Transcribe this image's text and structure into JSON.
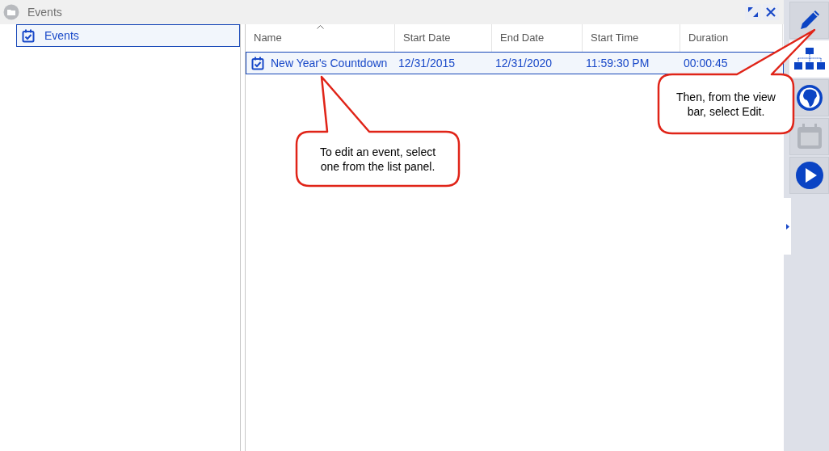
{
  "window": {
    "title": "Events"
  },
  "tree": {
    "items": [
      {
        "label": "Events",
        "selected": true
      }
    ]
  },
  "table": {
    "columns": [
      {
        "label": "Name",
        "sorted": true
      },
      {
        "label": "Start Date",
        "sorted": false
      },
      {
        "label": "End Date",
        "sorted": false
      },
      {
        "label": "Start Time",
        "sorted": false
      },
      {
        "label": "Duration",
        "sorted": false
      }
    ],
    "rows": [
      {
        "selected": true,
        "cells": [
          "New Year's Countdown",
          "12/31/2015",
          "12/31/2020",
          "11:59:30 PM",
          "00:00:45"
        ]
      }
    ]
  },
  "view_bar": {
    "buttons": [
      {
        "kind": "edit",
        "selected": false,
        "disabled": false
      },
      {
        "kind": "hierarchy",
        "selected": true,
        "disabled": false
      },
      {
        "kind": "globe",
        "selected": false,
        "disabled": false
      },
      {
        "kind": "calendar",
        "selected": false,
        "disabled": true
      },
      {
        "kind": "play",
        "selected": false,
        "disabled": false
      }
    ]
  },
  "callouts": [
    {
      "text": "To edit an event, select one from the list panel."
    },
    {
      "text": "Then, from the view bar, select Edit."
    }
  ]
}
